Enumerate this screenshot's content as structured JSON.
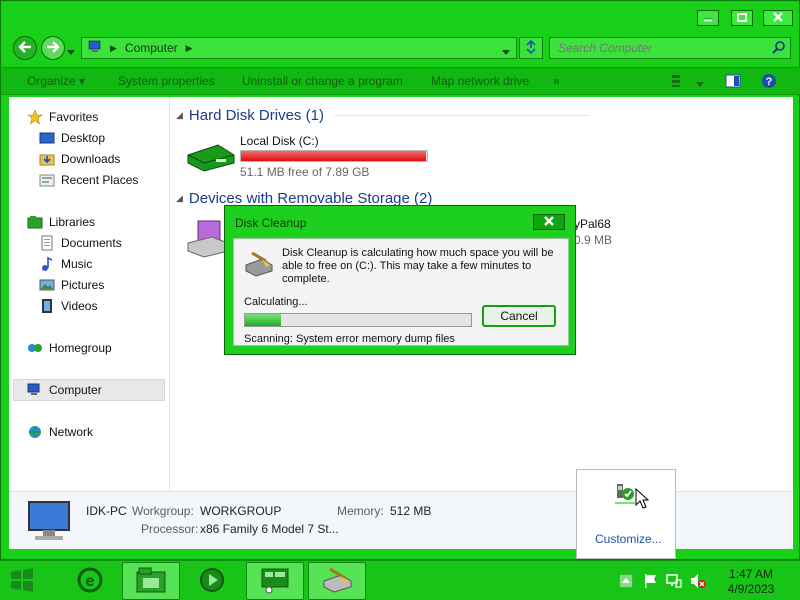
{
  "window": {
    "title_buttons": [
      "minimize",
      "maximize",
      "close"
    ]
  },
  "address_bar": {
    "path": "Computer",
    "search_placeholder": "Search Computer"
  },
  "toolbar": {
    "organize": "Organize ▾",
    "system_properties": "System properties",
    "uninstall": "Uninstall or change a program",
    "map_drive": "Map network drive",
    "more": "»"
  },
  "nav": {
    "favorites": "Favorites",
    "desktop": "Desktop",
    "downloads": "Downloads",
    "recent": "Recent Places",
    "libraries": "Libraries",
    "documents": "Documents",
    "music": "Music",
    "pictures": "Pictures",
    "videos": "Videos",
    "homegroup": "Homegroup",
    "computer": "Computer",
    "network": "Network"
  },
  "main": {
    "hdd_header": "Hard Disk Drives (1)",
    "drive_name": "Local Disk (C:)",
    "drive_free": "51.1 MB free of 7.89 GB",
    "drive_used_fraction": 0.994,
    "removable_header": "Devices with Removable Storage (2)",
    "removable_partial_name": "yPal68",
    "removable_partial_size": "0.9 MB"
  },
  "details": {
    "computer_name": "IDK-PC",
    "workgroup_label": "Workgroup:",
    "workgroup_value": "WORKGROUP",
    "memory_label": "Memory:",
    "memory_value": "512 MB",
    "processor_label": "Processor:",
    "processor_value": "x86 Family 6 Model 7 St..."
  },
  "dialog": {
    "title": "Disk Cleanup",
    "message": "Disk Cleanup is calculating how much space you will be able to free on  (C:). This may take a few minutes to complete.",
    "calculating": "Calculating...",
    "progress_fraction": 0.16,
    "scanning": "Scanning:   System error memory dump files",
    "cancel": "Cancel"
  },
  "tray_popup": {
    "customize": "Customize..."
  },
  "taskbar": {
    "time": "1:47 AM",
    "date": "4/9/2023"
  },
  "colors": {
    "theme_green": "#17d017",
    "drive_bar_red": "#d90f0f",
    "progress_green": "#1cb01c"
  }
}
